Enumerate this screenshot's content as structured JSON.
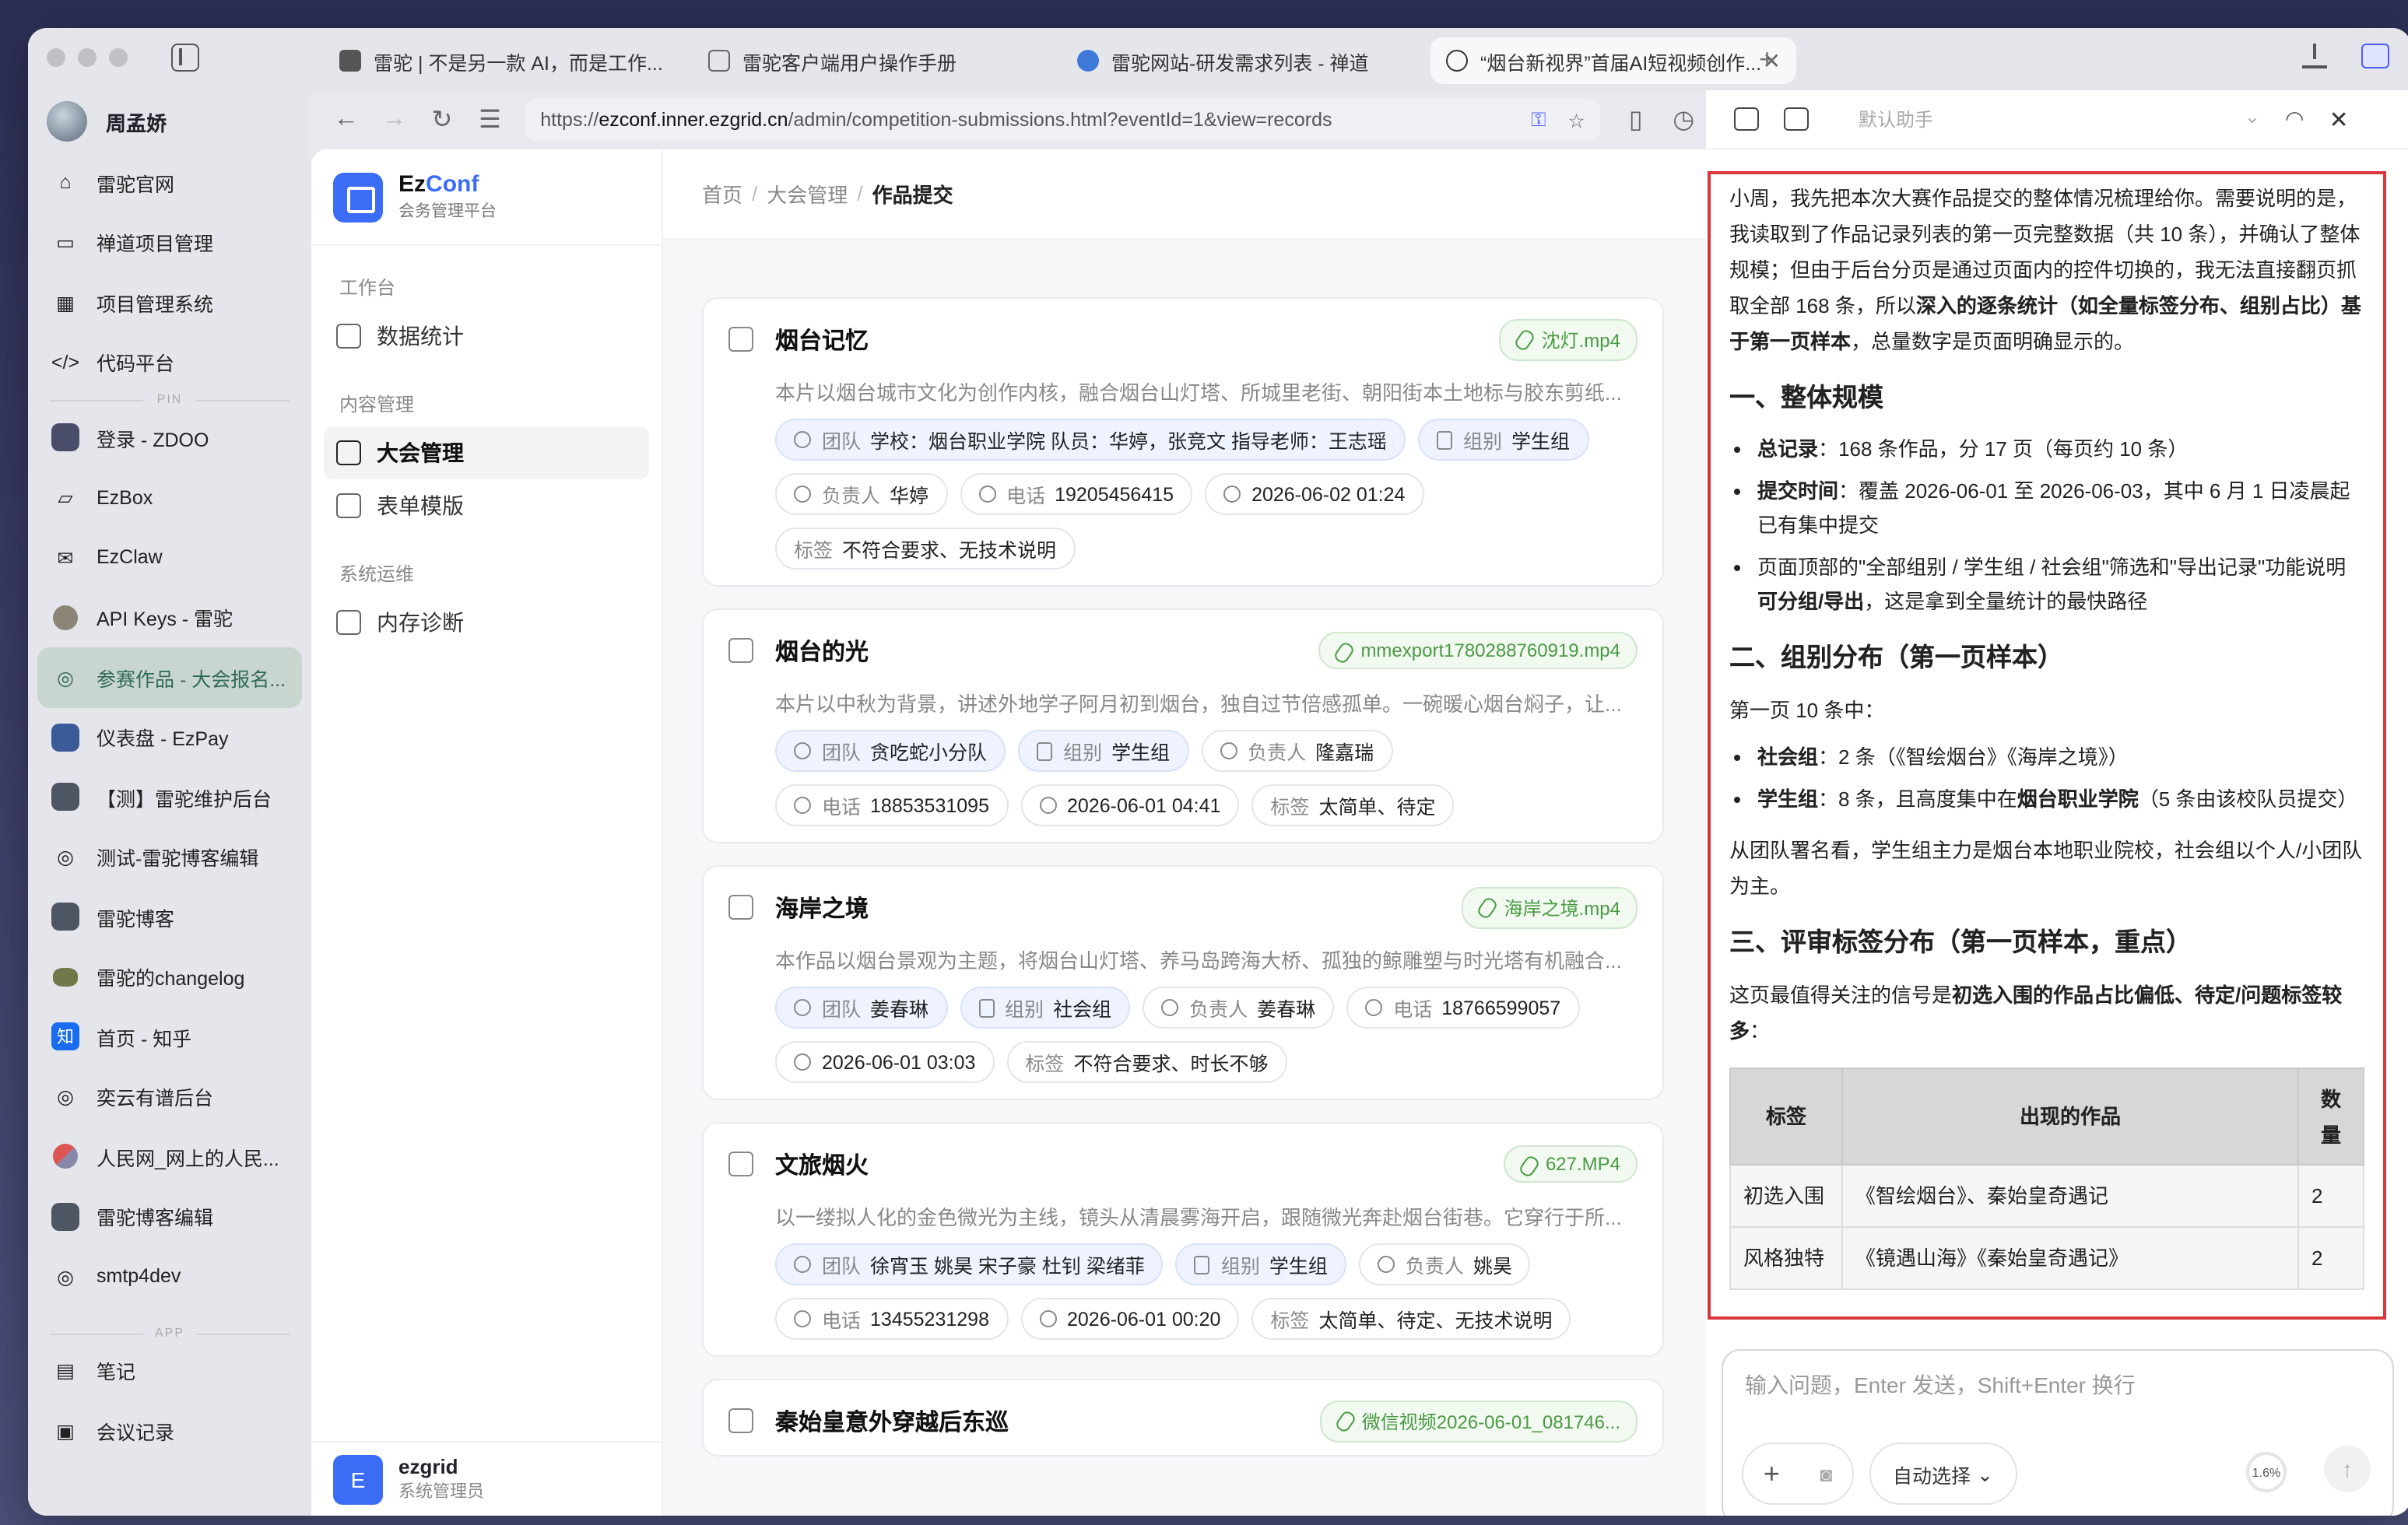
{
  "browser": {
    "tabs": [
      {
        "title": "雷驼 | 不是另一款 AI，而是工作..."
      },
      {
        "title": "雷驼客户端用户操作手册"
      },
      {
        "title": "雷驼网站-研发需求列表 - 禅道"
      },
      {
        "title": "“烟台新视界”首届AI短视频创作..."
      }
    ],
    "url_prefix": "https://",
    "url_host": "ezconf.inner.ezgrid.cn",
    "url_path": "/admin/competition-submissions.html?eventId=1&view=records",
    "profile_name": "周孟娇",
    "sidebar_items": [
      {
        "label": "雷驼官网",
        "icon": "home-icon"
      },
      {
        "label": "禅道项目管理",
        "icon": "briefcase-icon"
      },
      {
        "label": "项目管理系统",
        "icon": "grid-icon"
      },
      {
        "label": "代码平台",
        "icon": "code-icon"
      }
    ],
    "pin_label": "PIN",
    "pinned_items": [
      {
        "label": "登录 - ZDOO",
        "icon": "zdoo-icon"
      },
      {
        "label": "EzBox",
        "icon": "folder-icon"
      },
      {
        "label": "EzClaw",
        "icon": "mail-icon"
      },
      {
        "label": "API Keys - 雷驼",
        "icon": "camel-icon"
      },
      {
        "label": "参赛作品 - 大会报名...",
        "icon": "globe-icon",
        "active": true
      },
      {
        "label": "仪表盘 - EzPay",
        "icon": "ezpay-icon"
      },
      {
        "label": "【测】雷驼维护后台",
        "icon": "camel-icon"
      },
      {
        "label": "测试-雷驼博客编辑",
        "icon": "globe-icon"
      },
      {
        "label": "雷驼博客",
        "icon": "camel-icon"
      },
      {
        "label": "雷驼的changelog",
        "icon": "camel-icon"
      },
      {
        "label": "首页 - 知乎",
        "icon": "zhihu-icon"
      },
      {
        "label": "奕云有谱后台",
        "icon": "globe-icon"
      },
      {
        "label": "人民网_网上的人民...",
        "icon": "people-icon"
      },
      {
        "label": "雷驼博客编辑",
        "icon": "camel-icon"
      },
      {
        "label": "smtp4dev",
        "icon": "globe-icon"
      }
    ],
    "app_label": "APP",
    "app_items": [
      {
        "label": "笔记",
        "icon": "note-icon"
      },
      {
        "label": "会议记录",
        "icon": "calendar-icon"
      }
    ]
  },
  "app": {
    "brand_name_a": "Ez",
    "brand_name_b": "Conf",
    "brand_sub": "会务管理平台",
    "groups": [
      {
        "label": "工作台",
        "items": [
          {
            "label": "数据统计"
          }
        ]
      },
      {
        "label": "内容管理",
        "items": [
          {
            "label": "大会管理",
            "active": true
          },
          {
            "label": "表单模版"
          }
        ]
      },
      {
        "label": "系统运维",
        "items": [
          {
            "label": "内存诊断"
          }
        ]
      }
    ],
    "breadcrumb": [
      "首页",
      "大会管理",
      "作品提交"
    ],
    "user": {
      "initial": "E",
      "name": "ezgrid",
      "role": "系统管理员"
    },
    "labels": {
      "team": "团队",
      "group": "组别",
      "owner": "负责人",
      "phone": "电话",
      "tags": "标签"
    },
    "cards": [
      {
        "title": "烟台记忆",
        "file": "沈灯.mp4",
        "desc": "本片以烟台城市文化为创作内核，融合烟台山灯塔、所城里老街、朝阳街本土地标与胶东剪纸...",
        "team": "学校：烟台职业学院 队员：华婷，张竞文 指导老师：王志瑶",
        "group": "学生组",
        "owner": "华婷",
        "phone": "19205456415",
        "time": "2026-06-02 01:24",
        "tags": "不符合要求、无技术说明"
      },
      {
        "title": "烟台的光",
        "file": "mmexport1780288760919.mp4",
        "desc": "本片以中秋为背景，讲述外地学子阿月初到烟台，独自过节倍感孤单。一碗暖心烟台焖子，让...",
        "team": "贪吃蛇小分队",
        "group": "学生组",
        "owner": "隆嘉瑞",
        "phone": "18853531095",
        "time": "2026-06-01 04:41",
        "tags": "太简单、待定"
      },
      {
        "title": "海岸之境",
        "file": "海岸之境.mp4",
        "desc": "本作品以烟台景观为主题，将烟台山灯塔、养马岛跨海大桥、孤独的鲸雕塑与时光塔有机融合...",
        "team": "姜春琳",
        "group": "社会组",
        "owner": "姜春琳",
        "phone": "18766599057",
        "time": "2026-06-01 03:03",
        "tags": "不符合要求、时长不够"
      },
      {
        "title": "文旅烟火",
        "file": "627.MP4",
        "desc": "以一缕拟人化的金色微光为主线，镜头从清晨雾海开启，跟随微光奔赴烟台街巷。它穿行于所...",
        "team": "徐宵玉 姚昊 宋子豪 杜钊 梁绪菲",
        "group": "学生组",
        "owner": "姚昊",
        "phone": "13455231298",
        "time": "2026-06-01 00:20",
        "tags": "太简单、待定、无技术说明"
      },
      {
        "title": "秦始皇意外穿越后东巡",
        "file": "微信视频2026-06-01_081746..."
      }
    ]
  },
  "assistant": {
    "model_placeholder": "默认助手",
    "intro_pre": "小周，我先把本次大赛作品提交的整体情况梳理给你。需要说明的是，我读取到了作品记录列表的第一页完整数据（共 10 条），并确认了整体规模；但由于后台分页是通过页面内的控件切换的，我无法直接翻页抓取全部 168 条，所以",
    "intro_bold": "深入的逐条统计（如全量标签分布、组别占比）基于第一页样本",
    "intro_post": "，总量数字是页面明确显示的。",
    "h1": "一、整体规模",
    "s1": [
      {
        "b": "总记录",
        "t": "：168 条作品，分 17 页（每页约 10 条）"
      },
      {
        "b": "提交时间",
        "t": "：覆盖 2026-06-01 至 2026-06-03，其中 6 月 1 日凌晨起已有集中提交"
      },
      {
        "b": "",
        "t": "页面顶部的\"全部组别 / 学生组 / 社会组\"筛选和\"导出记录\"功能说明",
        "b2": "可分组/导出",
        "t2": "，这是拿到全量统计的最快路径"
      }
    ],
    "h2": "二、组别分布（第一页样本）",
    "p2": "第一页 10 条中：",
    "s2": [
      {
        "b": "社会组",
        "t": "：2 条（《智绘烟台》《海岸之境》）"
      },
      {
        "b": "学生组",
        "t": "：8 条，且高度集中在",
        "b2": "烟台职业学院",
        "t2": "（5 条由该校队员提交）"
      }
    ],
    "p2b": "从团队署名看，学生组主力是烟台本地职业院校，社会组以个人/小团队为主。",
    "h3": "三、评审标签分布（第一页样本，重点）",
    "p3_pre": "这页最值得关注的信号是",
    "p3_bold": "初选入围的作品占比偏低、待定/问题标签较多",
    "p3_post": "：",
    "table": {
      "headers": [
        "标签",
        "出现的作品",
        "数量"
      ],
      "rows": [
        [
          "初选入围",
          "《智绘烟台》、秦始皇奇遇记",
          "2"
        ],
        [
          "风格独特",
          "《镜遇山海》《秦始皇奇遇记》",
          "2"
        ]
      ]
    },
    "input_placeholder": "输入问题，Enter 发送，Shift+Enter 换行",
    "auto_select": "自动选择",
    "context_pct": "1.6%"
  }
}
